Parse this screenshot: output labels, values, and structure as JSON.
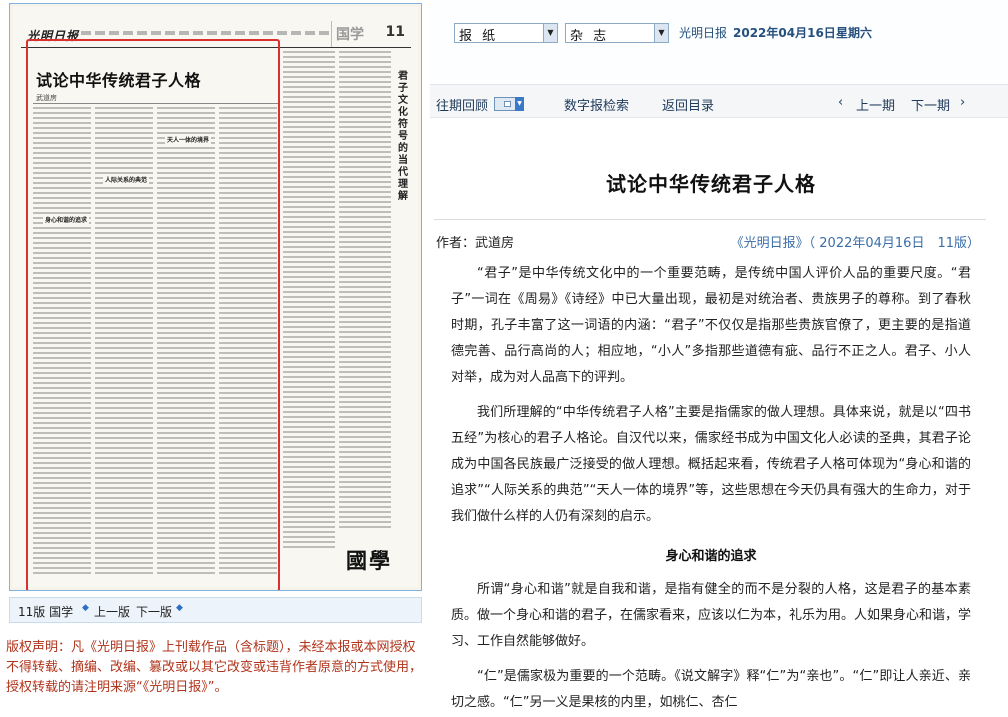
{
  "newspaper_page": {
    "masthead_logo": "光明日报",
    "section_name": "国学",
    "page_number": "11",
    "article_title": "试论中华传统君子人格",
    "article_author": "武道房",
    "side_article_title": "君子文化符号的当代理解",
    "section_logo": "國學",
    "subheads": [
      "身心和谐的追求",
      "人际关系的典范",
      "天人一体的境界"
    ]
  },
  "page_nav": {
    "page_label": "11版 国学",
    "prev_label": "上一版",
    "next_label": "下一版"
  },
  "copyright": "版权声明：凡《光明日报》上刊载作品（含标题），未经本报或本网授权不得转载、摘编、改编、篡改或以其它改变或违背作者原意的方式使用，授权转载的请注明来源“《光明日报》”。",
  "top_bar": {
    "select_1": "报 纸",
    "select_2": "杂 志",
    "paper_name": "光明日报",
    "date": "2022年04月16日",
    "weekday": "星期六"
  },
  "nav": {
    "archive": "往期回顾",
    "digital_search": "数字报检索",
    "back_to_index": "返回目录",
    "prev_page": "上一期",
    "next_page": "下一期"
  },
  "article": {
    "title": "试论中华传统君子人格",
    "author_line": "作者：武道房",
    "source_line": "《光明日报》（ 2022年04月16日　11版）",
    "paragraphs": [
      "“君子”是中华传统文化中的一个重要范畴，是传统中国人评价人品的重要尺度。“君子”一词在《周易》《诗经》中已大量出现，最初是对统治者、贵族男子的尊称。到了春秋时期，孔子丰富了这一词语的内涵：“君子”不仅仅是指那些贵族官僚了，更主要的是指道德完善、品行高尚的人；相应地，“小人”多指那些道德有疵、品行不正之人。君子、小人对举，成为对人品高下的评判。",
      "我们所理解的“中华传统君子人格”主要是指儒家的做人理想。具体来说，就是以“四书五经”为核心的君子人格论。自汉代以来，儒家经书成为中国文化人必读的圣典，其君子论成为中国各民族最广泛接受的做人理想。概括起来看，传统君子人格可体现为“身心和谐的追求”“人际关系的典范”“天人一体的境界”等，这些思想在今天仍具有强大的生命力，对于我们做什么样的人仍有深刻的启示。",
      "所谓“身心和谐”就是自我和谐，是指有健全的而不是分裂的人格，这是君子的基本素质。做一个身心和谐的君子，在儒家看来，应该以仁为本，礼乐为用。人如果身心和谐，学习、工作自然能够做好。",
      "“仁”是儒家极为重要的一个范畴。《说文解字》释“仁”为“亲也”。“仁”即让人亲近、亲切之感。“仁”另一义是果核的内里，如桃仁、杏仁"
    ],
    "subsection_1": "身心和谐的追求"
  }
}
